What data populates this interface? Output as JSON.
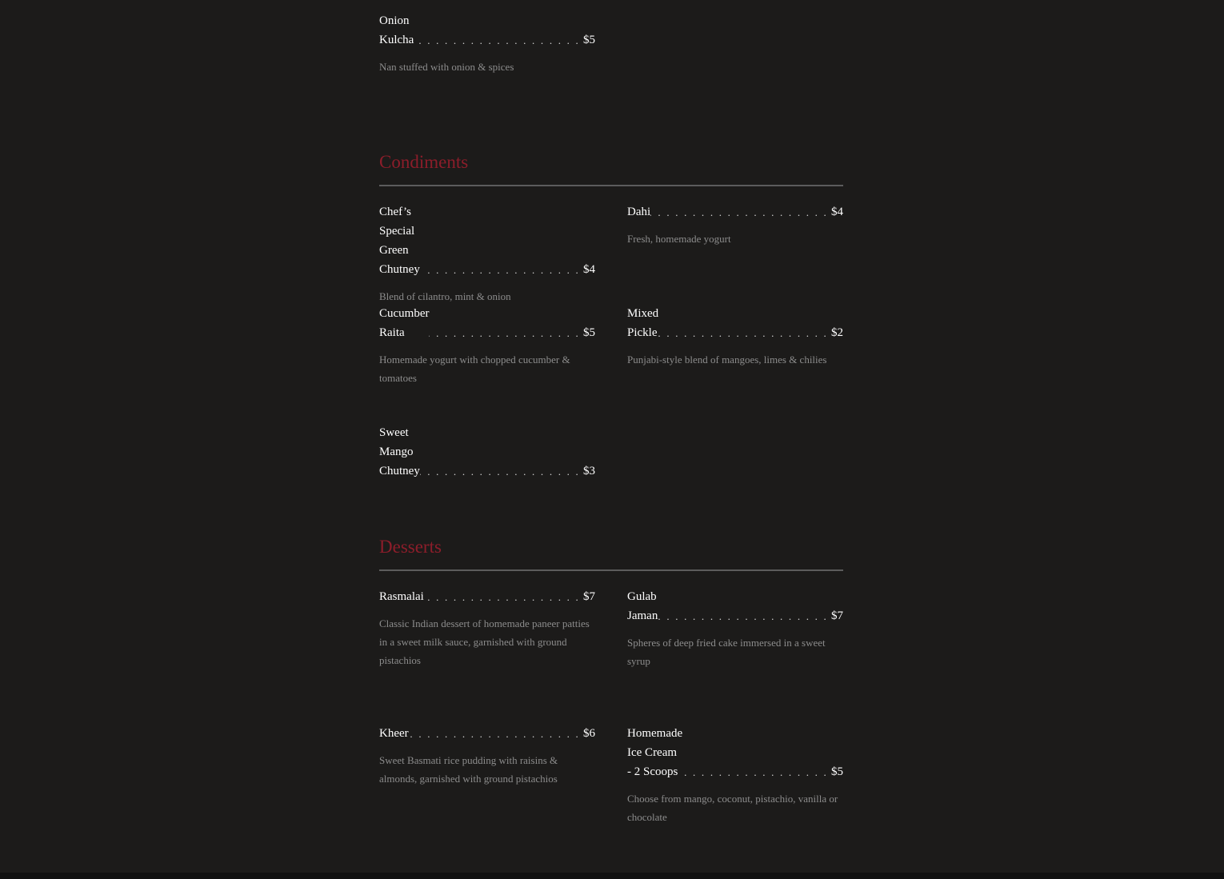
{
  "sections": {
    "breads": {
      "items": [
        {
          "name": "Onion Kulcha",
          "price": "$5",
          "desc": "Nan stuffed with onion & spices"
        }
      ]
    },
    "condiments": {
      "title": "Condiments",
      "items": [
        {
          "name": "Chef’s Special Green Chutney",
          "price": "$4",
          "desc": "Blend of cilantro, mint & onion"
        },
        {
          "name": "Dahi",
          "price": "$4",
          "desc": "Fresh, homemade yogurt"
        },
        {
          "name": "Cucumber Raita",
          "price": "$5",
          "desc": "Homemade yogurt with chopped cucumber & tomatoes"
        },
        {
          "name": "Mixed Pickle",
          "price": "$2",
          "desc": "Punjabi-style blend of mangoes, limes & chilies"
        },
        {
          "name": "Sweet Mango Chutney",
          "price": "$3",
          "desc": ""
        }
      ]
    },
    "desserts": {
      "title": "Desserts",
      "items": [
        {
          "name": "Rasmalai",
          "price": "$7",
          "desc": "Classic Indian dessert of homemade paneer patties in a sweet milk sauce, garnished with ground pistachios"
        },
        {
          "name": "Gulab Jaman",
          "price": "$7",
          "desc": "Spheres of deep fried cake immersed in a sweet syrup"
        },
        {
          "name": "Kheer",
          "price": "$6",
          "desc": "Sweet Basmati rice pudding with raisins & almonds, garnished with ground pistachios"
        },
        {
          "name": "Homemade Ice Cream - 2 Scoops",
          "price": "$5",
          "desc": "Choose from mango, coconut, pistachio, vanilla or chocolate"
        }
      ]
    }
  },
  "colors": {
    "background": "#1c1b1a",
    "section_title": "#8c1d2a",
    "item_name": "#ffffff",
    "item_desc": "#8c8c8c",
    "rule": "#5c5c5c"
  }
}
